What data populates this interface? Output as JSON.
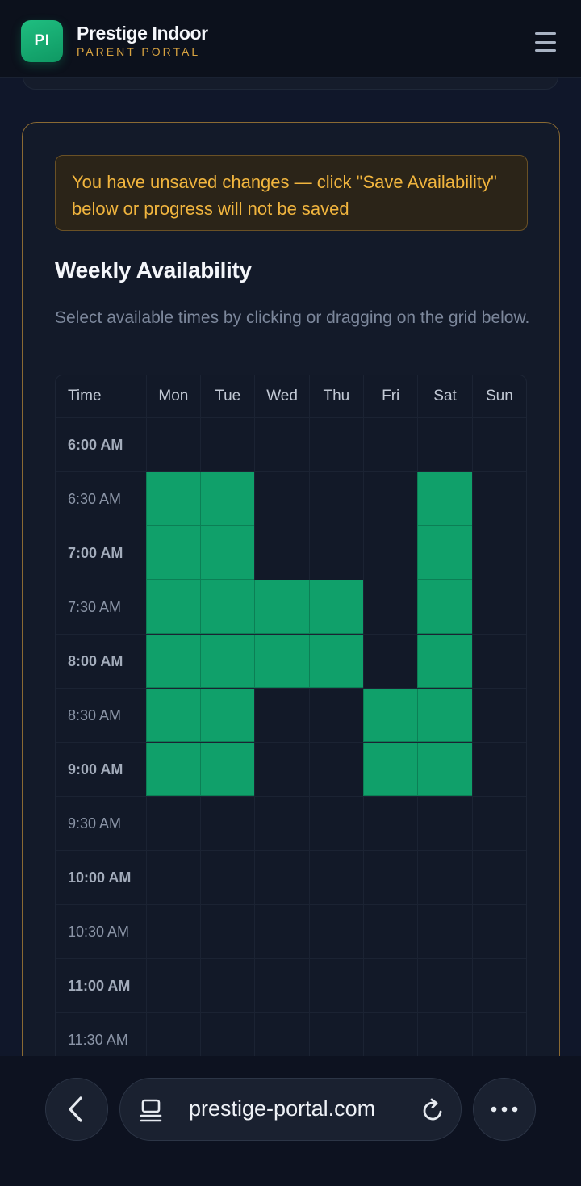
{
  "header": {
    "logo_text": "PI",
    "brand_name": "Prestige Indoor",
    "brand_subtitle": "PARENT PORTAL"
  },
  "warning": {
    "text": "You have unsaved changes — click \"Save Availability\" below or progress will not be saved"
  },
  "availability": {
    "title": "Weekly Availability",
    "description": "Select available times by clicking or dragging on the grid below.",
    "time_header": "Time",
    "days": [
      "Mon",
      "Tue",
      "Wed",
      "Thu",
      "Fri",
      "Sat",
      "Sun"
    ],
    "rows": [
      {
        "time": "6:00 AM",
        "selected": [
          false,
          false,
          false,
          false,
          false,
          false,
          false
        ]
      },
      {
        "time": "6:30 AM",
        "selected": [
          true,
          true,
          false,
          false,
          false,
          true,
          false
        ]
      },
      {
        "time": "7:00 AM",
        "selected": [
          true,
          true,
          false,
          false,
          false,
          true,
          false
        ]
      },
      {
        "time": "7:30 AM",
        "selected": [
          true,
          true,
          true,
          true,
          false,
          true,
          false
        ]
      },
      {
        "time": "8:00 AM",
        "selected": [
          true,
          true,
          true,
          true,
          false,
          true,
          false
        ]
      },
      {
        "time": "8:30 AM",
        "selected": [
          true,
          true,
          false,
          false,
          true,
          true,
          false
        ]
      },
      {
        "time": "9:00 AM",
        "selected": [
          true,
          true,
          false,
          false,
          true,
          true,
          false
        ]
      },
      {
        "time": "9:30 AM",
        "selected": [
          false,
          false,
          false,
          false,
          false,
          false,
          false
        ]
      },
      {
        "time": "10:00 AM",
        "selected": [
          false,
          false,
          false,
          false,
          false,
          false,
          false
        ]
      },
      {
        "time": "10:30 AM",
        "selected": [
          false,
          false,
          false,
          false,
          false,
          false,
          false
        ]
      },
      {
        "time": "11:00 AM",
        "selected": [
          false,
          false,
          false,
          false,
          false,
          false,
          false
        ]
      },
      {
        "time": "11:30 AM",
        "selected": [
          false,
          false,
          false,
          false,
          false,
          false,
          false
        ]
      }
    ]
  },
  "browser": {
    "url": "prestige-portal.com",
    "icons": [
      "back-icon",
      "site-info-icon",
      "reload-icon",
      "more-icon"
    ]
  },
  "colors": {
    "accent_green": "#10a06a",
    "warning_text": "#f1b53e",
    "card_border": "#8a6a33",
    "brand_subtitle": "#d9a441"
  }
}
